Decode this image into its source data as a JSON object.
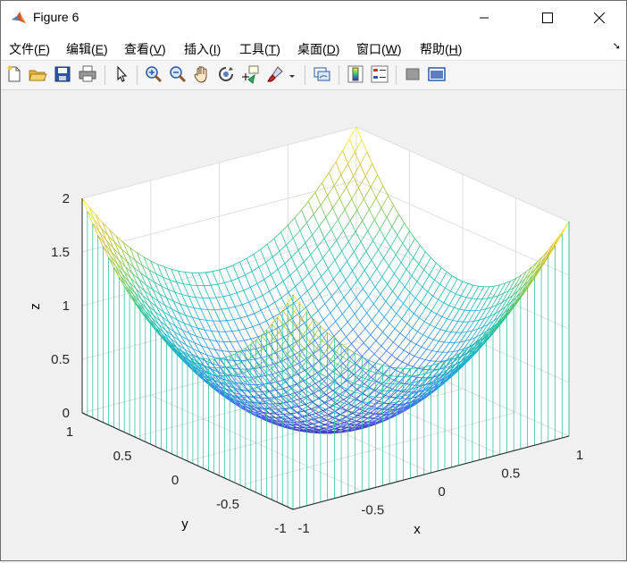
{
  "window": {
    "title": "Figure 6"
  },
  "menu": [
    {
      "label": "文件(",
      "key": "F",
      "tail": ")"
    },
    {
      "label": "编辑(",
      "key": "E",
      "tail": ")"
    },
    {
      "label": "查看(",
      "key": "V",
      "tail": ")"
    },
    {
      "label": "插入(",
      "key": "I",
      "tail": ")"
    },
    {
      "label": "工具(",
      "key": "T",
      "tail": ")"
    },
    {
      "label": "桌面(",
      "key": "D",
      "tail": ")"
    },
    {
      "label": "窗口(",
      "key": "W",
      "tail": ")"
    },
    {
      "label": "帮助(",
      "key": "H",
      "tail": ")"
    }
  ],
  "toolbar": [
    "new-file-icon",
    "open-folder-icon",
    "save-icon",
    "print-icon",
    "pointer-icon",
    "zoom-in-icon",
    "zoom-out-icon",
    "pan-hand-icon",
    "rotate-3d-icon",
    "data-cursor-icon",
    "brush-icon",
    "brush-dropdown-icon",
    "link-plot-icon",
    "colorbar-icon",
    "legend-icon",
    "hide-plot-tools-icon",
    "show-plot-tools-icon"
  ],
  "chart_data": {
    "type": "mesh3d",
    "function": "z = x^2 + y^2 (drawn with meshz curtain)",
    "x_range": [
      -1,
      1
    ],
    "y_range": [
      -1,
      1
    ],
    "z_range": [
      0,
      2
    ],
    "grid_points": 41,
    "xlabel": "x",
    "ylabel": "y",
    "zlabel": "z",
    "x_ticks": [
      "-1",
      "-0.5",
      "0",
      "0.5",
      "1"
    ],
    "y_ticks": [
      "-1",
      "-0.5",
      "0",
      "0.5",
      "1"
    ],
    "z_ticks": [
      "0",
      "0.5",
      "1",
      "1.5",
      "2"
    ],
    "colormap": "parula",
    "colormap_colors": [
      "#3e26a8",
      "#4768f9",
      "#2497e4",
      "#16b6c9",
      "#31c493",
      "#8ec840",
      "#e4ba2d",
      "#f9fb15"
    ]
  }
}
